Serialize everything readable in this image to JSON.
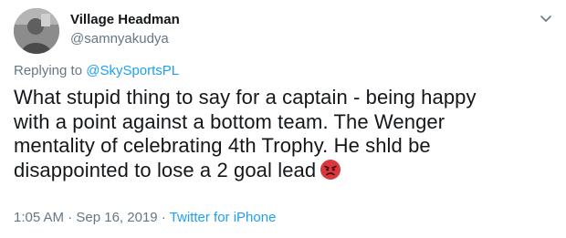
{
  "user": {
    "display_name": "Village Headman",
    "handle": "@samnyakudya",
    "avatar_icon": "user-avatar"
  },
  "reply": {
    "prefix": "Replying to ",
    "mention": "@SkySportsPL"
  },
  "tweet": {
    "lines": [
      "What stupid thing to say for a captain - being happy",
      "with a point against a bottom team. The Wenger",
      "mentality of celebrating 4th Trophy. He shld be",
      "disappointed to lose a 2 goal lead"
    ],
    "emoji": "angry-face-icon"
  },
  "meta": {
    "time": "1:05 AM",
    "separator1": " · ",
    "date": "Sep 16, 2019",
    "separator2": " · ",
    "source": "Twitter for iPhone"
  },
  "colors": {
    "link": "#1da1f2",
    "secondary": "#657786",
    "primary": "#14171a",
    "emoji_red": "#d9363e"
  }
}
